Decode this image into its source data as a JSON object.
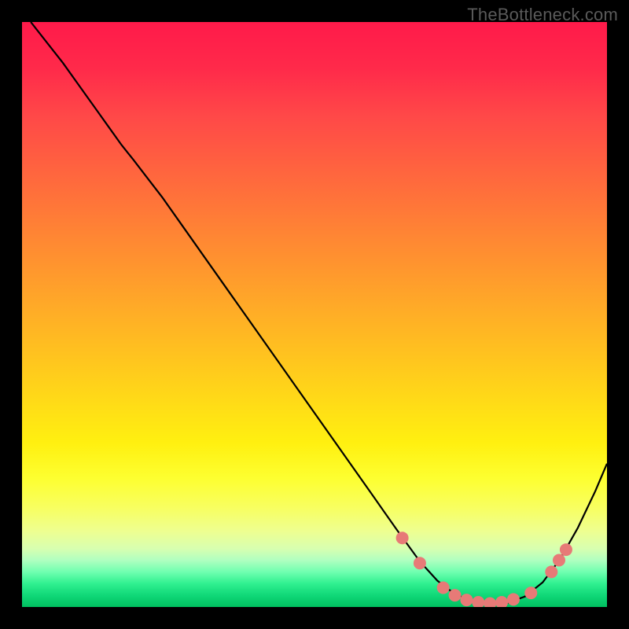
{
  "watermark": "TheBottleneck.com",
  "chart_data": {
    "type": "line",
    "title": "",
    "xlabel": "",
    "ylabel": "",
    "xlim": [
      0,
      1
    ],
    "ylim": [
      0,
      1
    ],
    "curve_points": [
      [
        0.015,
        1.0
      ],
      [
        0.07,
        0.93
      ],
      [
        0.12,
        0.86
      ],
      [
        0.17,
        0.79
      ],
      [
        0.19,
        0.765
      ],
      [
        0.24,
        0.7
      ],
      [
        0.3,
        0.615
      ],
      [
        0.36,
        0.53
      ],
      [
        0.42,
        0.445
      ],
      [
        0.48,
        0.36
      ],
      [
        0.54,
        0.275
      ],
      [
        0.6,
        0.19
      ],
      [
        0.64,
        0.133
      ],
      [
        0.68,
        0.078
      ],
      [
        0.71,
        0.045
      ],
      [
        0.74,
        0.022
      ],
      [
        0.77,
        0.01
      ],
      [
        0.8,
        0.005
      ],
      [
        0.83,
        0.007
      ],
      [
        0.86,
        0.018
      ],
      [
        0.89,
        0.042
      ],
      [
        0.92,
        0.082
      ],
      [
        0.95,
        0.135
      ],
      [
        0.98,
        0.198
      ],
      [
        1.0,
        0.245
      ]
    ],
    "markers": [
      [
        0.65,
        0.118
      ],
      [
        0.68,
        0.075
      ],
      [
        0.72,
        0.033
      ],
      [
        0.74,
        0.02
      ],
      [
        0.76,
        0.012
      ],
      [
        0.78,
        0.008
      ],
      [
        0.8,
        0.006
      ],
      [
        0.82,
        0.008
      ],
      [
        0.84,
        0.013
      ],
      [
        0.87,
        0.024
      ],
      [
        0.905,
        0.06
      ],
      [
        0.918,
        0.08
      ],
      [
        0.93,
        0.098
      ]
    ],
    "marker_radius": 8,
    "colors": {
      "curve": "#000000",
      "markers": "#e77a77",
      "gradient_top": "#ff1a4a",
      "gradient_mid": "#ffd818",
      "gradient_bottom": "#00c060"
    }
  }
}
